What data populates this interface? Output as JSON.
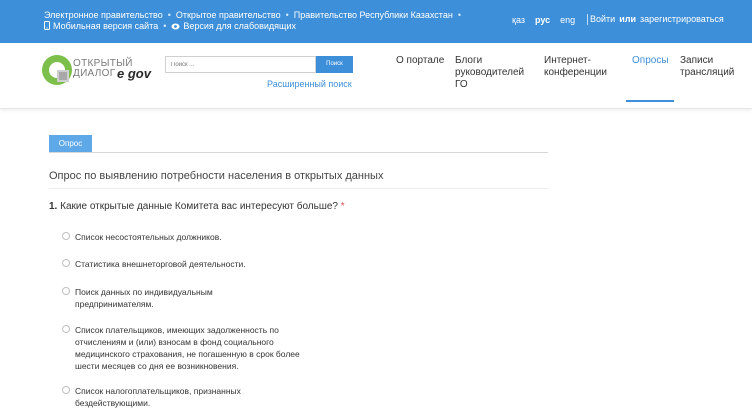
{
  "topbar": {
    "links_row1": [
      "Электронное правительство",
      "Открытое правительство",
      "Правительство Республики Казахстан"
    ],
    "mobile_label": "Мобильная версия сайта",
    "visually_impaired_label": "Версия для слабовидящих",
    "languages": [
      "қаз",
      "рус",
      "eng"
    ],
    "active_language": "рус",
    "login_label": "Войти",
    "or_label": "или",
    "register_label": "зарегистрироваться"
  },
  "header": {
    "logo_line1": "ОТКРЫТЫЙ",
    "logo_line2": "ДИАЛОГ",
    "logo_egov": "e gov",
    "search_placeholder": "Поиск ...",
    "search_button": "Поиск",
    "advanced_search": "Расширенный поиск",
    "nav": [
      {
        "label": "О портале",
        "active": false
      },
      {
        "label": "Блоги руководителей ГО",
        "active": false
      },
      {
        "label": "Интернет-конференции",
        "active": false
      },
      {
        "label": "Опросы",
        "active": true
      },
      {
        "label": "Записи трансляций",
        "active": false
      }
    ]
  },
  "content": {
    "tab_label": "Опрос",
    "survey_title": "Опрос по выявлению потребности населения в открытых данных",
    "question_number": "1.",
    "question_text": "Какие открытые данные Комитета вас интересуют больше?",
    "required_mark": "*",
    "options": [
      "Список несостоятельных должников.",
      "Статистика внешнеторговой деятельности.",
      "Поиск данных по индивидуальным предпринимателям.",
      "Список плательщиков, имеющих задолженность по отчислениям и (или) взносам в фонд социального медицинского страхования, не погашенную в срок более шести месяцев со дня ее возникновения.",
      "Список налогоплательщиков, признанных бездействующими."
    ]
  },
  "colors": {
    "primary": "#3d8fd9",
    "tab": "#5fa8e8",
    "logo_green": "#7cc04b",
    "required": "#e05050"
  }
}
